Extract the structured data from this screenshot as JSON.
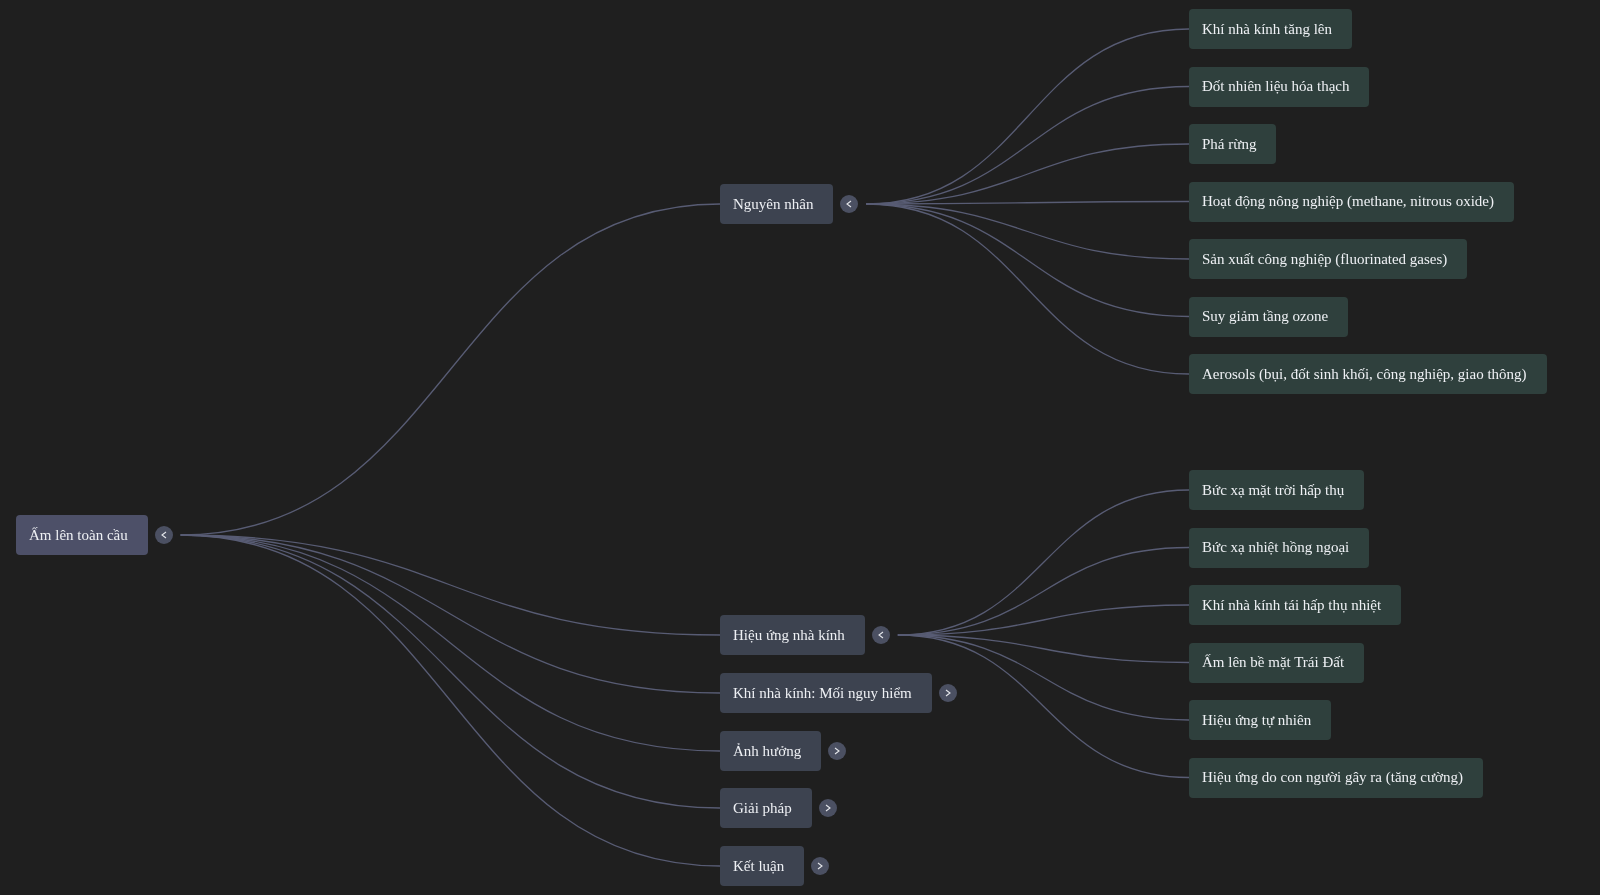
{
  "mind_map": {
    "label": "Ấm lên toàn cầu",
    "expanded": true,
    "children": [
      {
        "label": "Nguyên nhân",
        "expanded": true,
        "children": [
          {
            "label": "Khí nhà kính tăng lên"
          },
          {
            "label": "Đốt nhiên liệu hóa thạch"
          },
          {
            "label": "Phá rừng"
          },
          {
            "label": "Hoạt động nông nghiệp (methane, nitrous oxide)"
          },
          {
            "label": "Sản xuất công nghiệp (fluorinated gases)"
          },
          {
            "label": "Suy giảm tầng ozone"
          },
          {
            "label": "Aerosols (bụi, đốt sinh khối, công nghiệp, giao thông)"
          }
        ]
      },
      {
        "label": "Hiệu ứng nhà kính",
        "expanded": true,
        "children": [
          {
            "label": "Bức xạ mặt trời hấp thụ"
          },
          {
            "label": "Bức xạ nhiệt hồng ngoại"
          },
          {
            "label": "Khí nhà kính tái hấp thụ nhiệt"
          },
          {
            "label": "Ấm lên bề mặt Trái Đất"
          },
          {
            "label": "Hiệu ứng tự nhiên"
          },
          {
            "label": "Hiệu ứng do con người gây ra (tăng cường)"
          }
        ]
      },
      {
        "label": "Khí nhà kính: Mối nguy hiểm",
        "expanded": false
      },
      {
        "label": "Ảnh hưởng",
        "expanded": false
      },
      {
        "label": "Giải pháp",
        "expanded": false
      },
      {
        "label": "Kết luận",
        "expanded": false
      }
    ]
  }
}
